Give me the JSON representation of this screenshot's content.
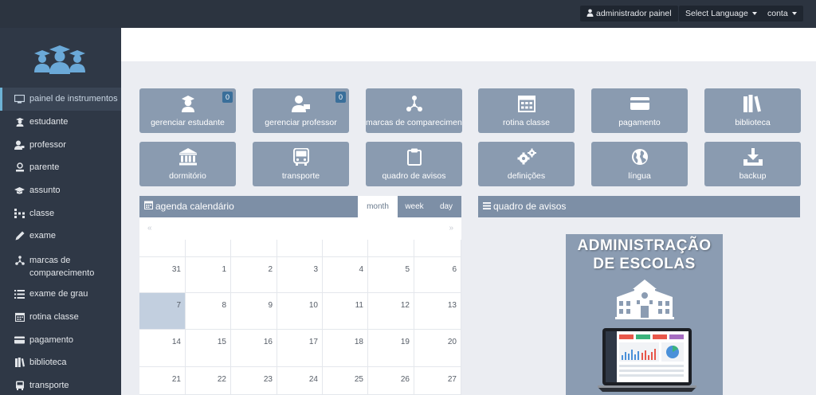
{
  "topbar": {
    "user_label": "administrador painel",
    "language_label": "Select Language",
    "account_label": "conta"
  },
  "sidebar": {
    "items": [
      {
        "label": "painel de instrumentos",
        "icon": "monitor-icon",
        "active": true
      },
      {
        "label": "estudante",
        "icon": "student-icon"
      },
      {
        "label": "professor",
        "icon": "teacher-icon"
      },
      {
        "label": "parente",
        "icon": "parent-icon"
      },
      {
        "label": "assunto",
        "icon": "graduation-cap-icon"
      },
      {
        "label": "classe",
        "icon": "class-icon"
      },
      {
        "label": "exame",
        "icon": "pencil-icon"
      },
      {
        "label": "marcas de comparecimento",
        "icon": "share-nodes-icon"
      },
      {
        "label": "exame de grau",
        "icon": "list-icon"
      },
      {
        "label": "rotina classe",
        "icon": "calendar-icon"
      },
      {
        "label": "pagamento",
        "icon": "credit-card-icon"
      },
      {
        "label": "biblioteca",
        "icon": "books-icon"
      },
      {
        "label": "transporte",
        "icon": "bus-icon"
      }
    ]
  },
  "tiles": [
    {
      "label": "gerenciar estudante",
      "icon": "student-icon",
      "badge": "0"
    },
    {
      "label": "gerenciar professor",
      "icon": "teacher-icon",
      "badge": "0"
    },
    {
      "label": "marcas de comparecimento",
      "icon": "share-nodes-icon"
    },
    {
      "label": "rotina classe",
      "icon": "calendar-icon"
    },
    {
      "label": "pagamento",
      "icon": "credit-card-icon"
    },
    {
      "label": "biblioteca",
      "icon": "books-icon"
    },
    {
      "label": "dormitório",
      "icon": "bank-icon"
    },
    {
      "label": "transporte",
      "icon": "bus-icon"
    },
    {
      "label": "quadro de avisos",
      "icon": "clipboard-icon"
    },
    {
      "label": "definições",
      "icon": "gears-icon"
    },
    {
      "label": "língua",
      "icon": "globe-icon"
    },
    {
      "label": "backup",
      "icon": "download-icon"
    }
  ],
  "calendar": {
    "title": "agenda calendário",
    "views": [
      "month",
      "week",
      "day"
    ],
    "selected_view": "month",
    "prev": "«",
    "next": "»",
    "weeks": [
      [
        "31",
        "1",
        "2",
        "3",
        "4",
        "5",
        "6"
      ],
      [
        "7",
        "8",
        "9",
        "10",
        "11",
        "12",
        "13"
      ],
      [
        "14",
        "15",
        "16",
        "17",
        "18",
        "19",
        "20"
      ],
      [
        "21",
        "22",
        "23",
        "24",
        "25",
        "26",
        "27"
      ]
    ],
    "today": "7"
  },
  "notice": {
    "title": "quadro de avisos"
  },
  "promo": {
    "line1": "ADMINISTRAÇÃO",
    "line2": "DE ESCOLAS"
  },
  "colors": {
    "topbar": "#2c3440",
    "sidebar": "#2f3846",
    "tile": "#8a9bb0",
    "panel_header": "#7d8fa6",
    "today": "#c2cfdf",
    "badge": "#3a6f9a"
  }
}
